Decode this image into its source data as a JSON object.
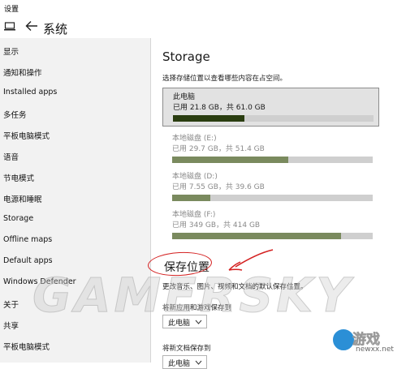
{
  "window": {
    "title": "设置"
  },
  "header": {
    "title": "系统",
    "home_icon": "pc-icon",
    "back_icon": "back-arrow-icon"
  },
  "sidebar": {
    "items": [
      {
        "label": "显示"
      },
      {
        "label": "通知和操作"
      },
      {
        "label": "Installed apps"
      },
      {
        "label": "多任务"
      },
      {
        "label": "平板电脑模式"
      },
      {
        "label": "语音"
      },
      {
        "label": "节电模式"
      },
      {
        "label": "电源和睡眠"
      },
      {
        "label": "Storage"
      },
      {
        "label": "Offline maps"
      },
      {
        "label": "Default apps"
      },
      {
        "label": "Windows Defender"
      },
      {
        "label": "关于"
      },
      {
        "label": "共享"
      },
      {
        "label": "平板电脑模式"
      }
    ]
  },
  "storage": {
    "title": "Storage",
    "description": "选择存储位置以查看哪些内容在占空间。",
    "drives": [
      {
        "name": "此电脑",
        "usage": "已用 21.8 GB，共 61.0 GB",
        "used_fraction": 0.357,
        "color": "#2a3d10",
        "selected": true
      },
      {
        "name": "本地磁盘 (E:)",
        "usage": "已用 29.7 GB，共 51.4 GB",
        "used_fraction": 0.578,
        "color": "#7a8a5e",
        "selected": false
      },
      {
        "name": "本地磁盘 (D:)",
        "usage": "已用 7.55 GB，共 39.6 GB",
        "used_fraction": 0.191,
        "color": "#7a8a5e",
        "selected": false
      },
      {
        "name": "本地磁盘 (F:)",
        "usage": "已用 349 GB，共 414 GB",
        "used_fraction": 0.843,
        "color": "#7a8a5e",
        "selected": false
      }
    ]
  },
  "save_locations": {
    "title": "保存位置",
    "description": "更改音乐、图片、视频和文档的默认保存位置。",
    "new_apps_label": "将新应用和游戏保存到",
    "new_apps_value": "此电脑",
    "new_docs_label": "将新文档保存到",
    "new_docs_value": "此电脑"
  },
  "watermark": {
    "text": "GAMERSKY",
    "brand": "游戏",
    "url": "newxx.net"
  },
  "colors": {
    "sidebar_bg": "#f2f2f2",
    "annotation_red": "#d42020"
  }
}
